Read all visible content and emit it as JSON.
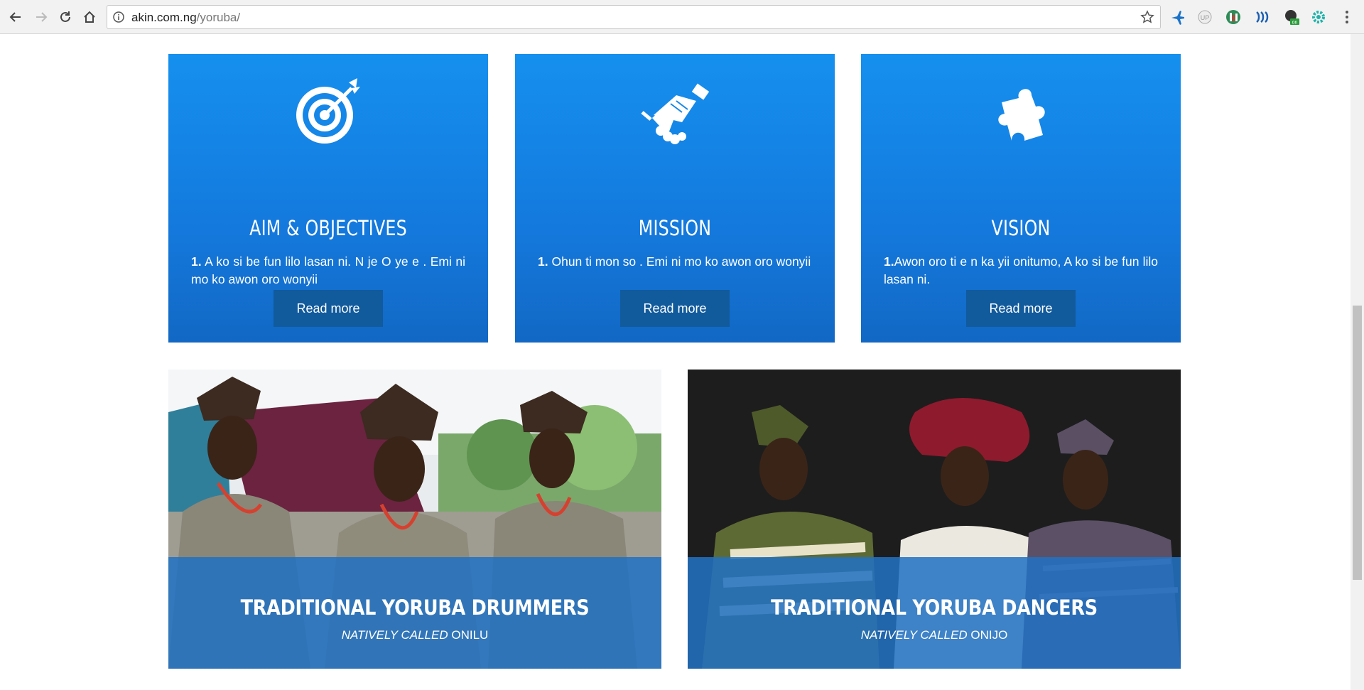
{
  "browser": {
    "url_host": "akin.com.ng",
    "url_path": "/yoruba/"
  },
  "cards": [
    {
      "icon": "target-icon",
      "title": "AIM & OBJECTIVES",
      "num": "1.",
      "text": " A ko si be fun lilo lasan ni. N je O ye e . Emi ni mo ko awon oro wonyii",
      "button": "Read more"
    },
    {
      "icon": "handshake-icon",
      "title": "MISSION",
      "num": "1.",
      "text": " Ohun ti mon so . Emi ni mo ko awon oro wonyii",
      "button": "Read more"
    },
    {
      "icon": "puzzle-icon",
      "title": "VISION",
      "num": "1.",
      "text": "Awon oro ti e n ka yii onitumo, A ko si be fun lilo lasan ni.",
      "button": "Read more"
    }
  ],
  "tiles": [
    {
      "title": "TRADITIONAL YORUBA DRUMMERS",
      "sub_italic": "NATIVELY CALLED",
      "sub_name": " ONILU"
    },
    {
      "title": "TRADITIONAL YORUBA DANCERS",
      "sub_italic": "NATIVELY CALLED",
      "sub_name": " ONIJO"
    }
  ],
  "colors": {
    "card_blue": "#1589ea",
    "button_blue": "#115a9c",
    "overlay_blue": "#2271c2"
  }
}
